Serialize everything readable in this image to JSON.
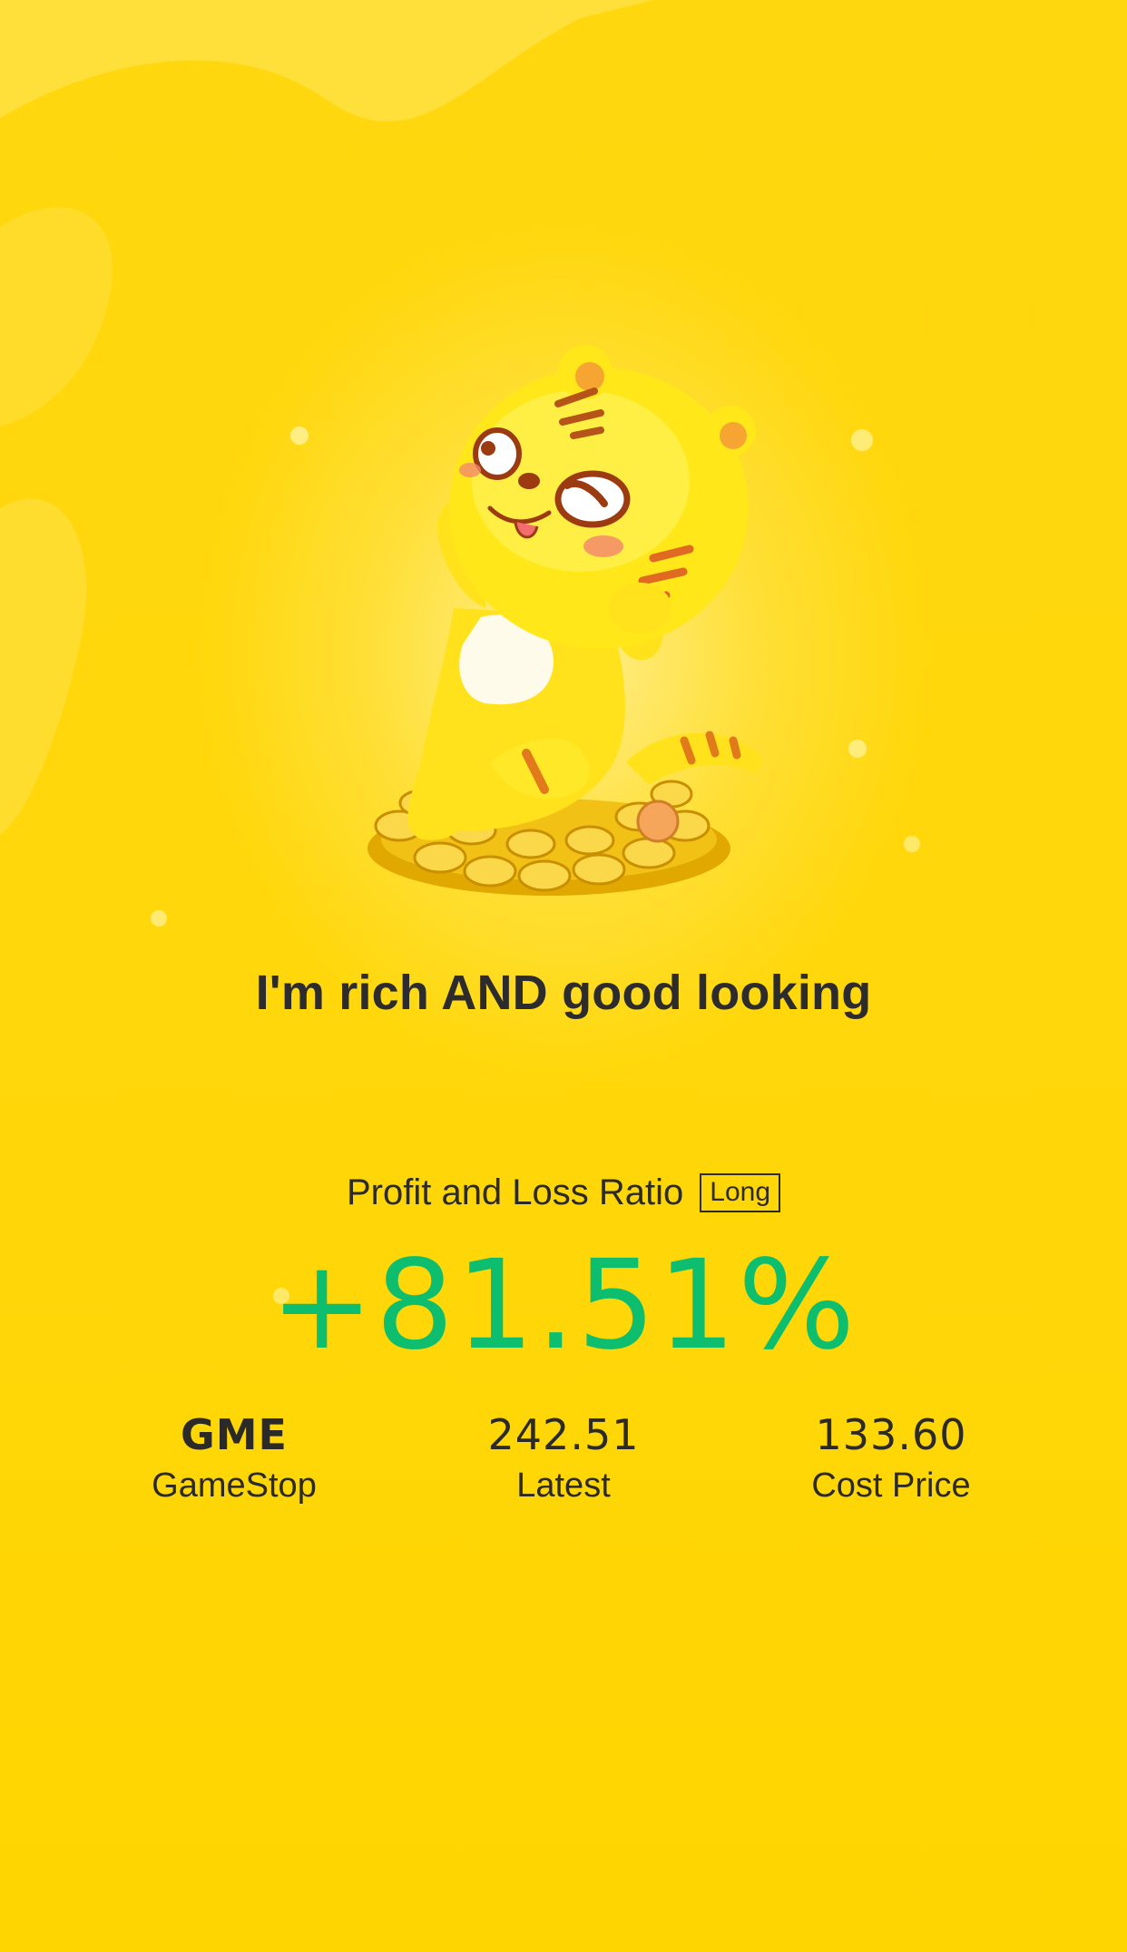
{
  "headline": "I'm rich AND good looking",
  "profit_loss": {
    "label": "Profit and Loss Ratio",
    "badge": "Long",
    "ratio": "+81.51%"
  },
  "stats": {
    "symbol": {
      "value": "GME",
      "label": "GameStop"
    },
    "latest": {
      "value": "242.51",
      "label": "Latest"
    },
    "cost": {
      "value": "133.60",
      "label": "Cost Price"
    }
  },
  "colors": {
    "background": "#FFD60A",
    "ratio": "#0DBE6E",
    "text": "#2C2B2D"
  },
  "illustration": "tiger-mascot-on-gold-coins"
}
